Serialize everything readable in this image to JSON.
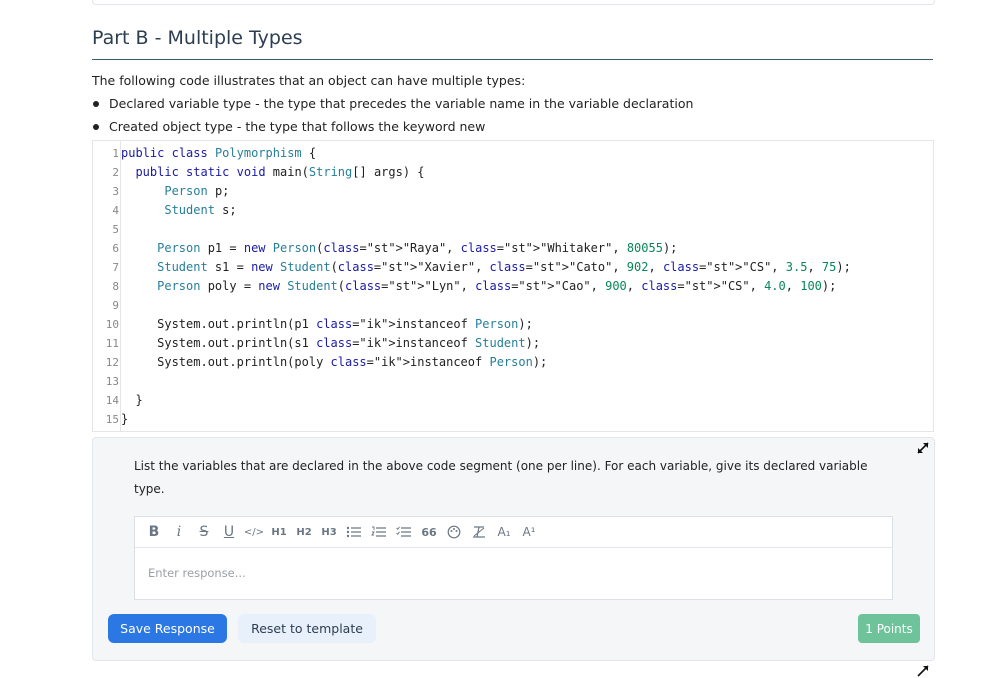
{
  "section": {
    "title": "Part B - Multiple Types",
    "intro": "The following code illustrates that an object can have multiple types:",
    "bullets": [
      "Declared variable type - the type that precedes the variable name in the variable declaration",
      "Created object type - the type that follows the keyword new"
    ]
  },
  "code": {
    "line_numbers": [
      "1",
      "2",
      "3",
      "4",
      "5",
      "6",
      "7",
      "8",
      "9",
      "10",
      "11",
      "12",
      "13",
      "14",
      "15"
    ],
    "lines": [
      "public class Polymorphism {",
      "  public static void main(String[] args) {",
      "      Person p;",
      "      Student s;",
      "",
      "     Person p1 = new Person(\"Raya\", \"Whitaker\", 80055);",
      "     Student s1 = new Student(\"Xavier\", \"Cato\", 902, \"CS\", 3.5, 75);",
      "     Person poly = new Student(\"Lyn\", \"Cao\", 900, \"CS\", 4.0, 100);",
      "",
      "     System.out.println(p1 instanceof Person);",
      "     System.out.println(s1 instanceof Student);",
      "     System.out.println(poly instanceof Person);",
      "",
      "  }",
      "}"
    ]
  },
  "question": {
    "prompt": "List the variables that are declared in the above code segment (one per line). For each variable, give its declared variable type.",
    "toolbar": {
      "bold": "B",
      "italic": "i",
      "strike": "S",
      "underline": "U",
      "code": "</>",
      "h1": "H1",
      "h2": "H2",
      "h3": "H3",
      "quote": "66",
      "subscript": "A₁",
      "superscript": "A¹"
    },
    "placeholder": "Enter response...",
    "response_value": ""
  },
  "actions": {
    "save_label": "Save Response",
    "reset_label": "Reset to template",
    "points_label": "1 Points"
  },
  "colors": {
    "title": "#2c3e50",
    "save_button": "#2b78e4",
    "reset_button": "#e8f0fc",
    "points_badge": "#6ec39a"
  }
}
